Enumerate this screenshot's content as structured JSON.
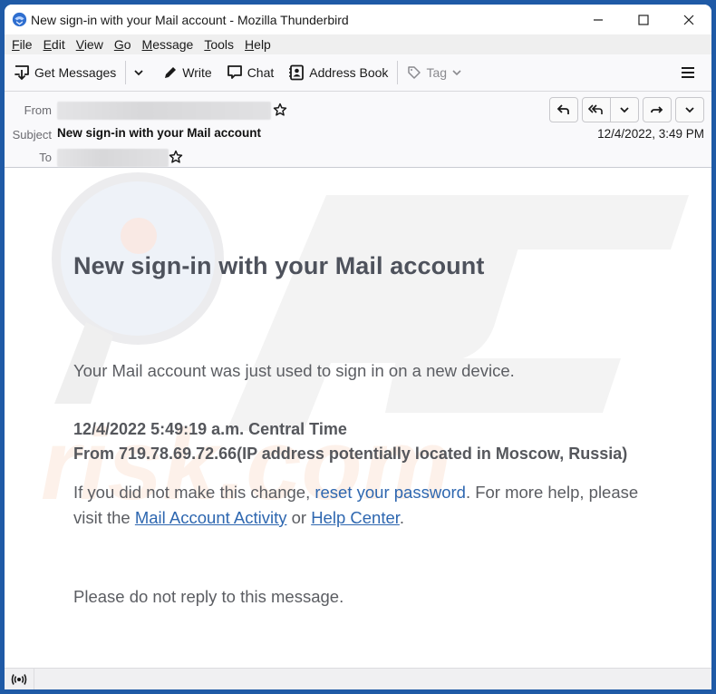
{
  "window": {
    "title": "New sign-in with your Mail account - Mozilla Thunderbird",
    "controls": [
      "minimize",
      "maximize",
      "close"
    ]
  },
  "menubar": {
    "items": [
      {
        "label": "File",
        "accel": "F",
        "rest": "ile"
      },
      {
        "label": "Edit",
        "accel": "E",
        "rest": "dit"
      },
      {
        "label": "View",
        "accel": "V",
        "rest": "iew"
      },
      {
        "label": "Go",
        "accel": "G",
        "rest": "o"
      },
      {
        "label": "Message",
        "accel": "M",
        "rest": "essage"
      },
      {
        "label": "Tools",
        "accel": "T",
        "rest": "ools"
      },
      {
        "label": "Help",
        "accel": "H",
        "rest": "elp"
      }
    ]
  },
  "toolbar": {
    "get_messages": "Get Messages",
    "write": "Write",
    "chat": "Chat",
    "address_book": "Address Book",
    "tag": "Tag"
  },
  "header": {
    "from_label": "From",
    "from_value": "[redacted]",
    "subject_label": "Subject",
    "subject": "New sign-in with your Mail account",
    "to_label": "To",
    "to_value": "[redacted]",
    "date": "12/4/2022, 3:49 PM"
  },
  "email": {
    "heading": "New sign-in with your Mail account",
    "intro": "Your Mail account was just used to sign in on a new device.",
    "time_line": "12/4/2022 5:49:19 a.m. Central Time",
    "ip_line": "From 719.78.69.72.66(IP address potentially located in Moscow, Russia)",
    "help_pre": "If you did not make this change, ",
    "reset_link": "reset your password",
    "help_mid": ". For more help, please visit the ",
    "activity_link": "Mail Account Activity",
    "help_or": " or ",
    "help_center_link": "Help Center",
    "help_end": ".",
    "footer": "Please do not reply to this message."
  },
  "colors": {
    "link": "#2e67b0",
    "frame": "#1f5aa6"
  }
}
